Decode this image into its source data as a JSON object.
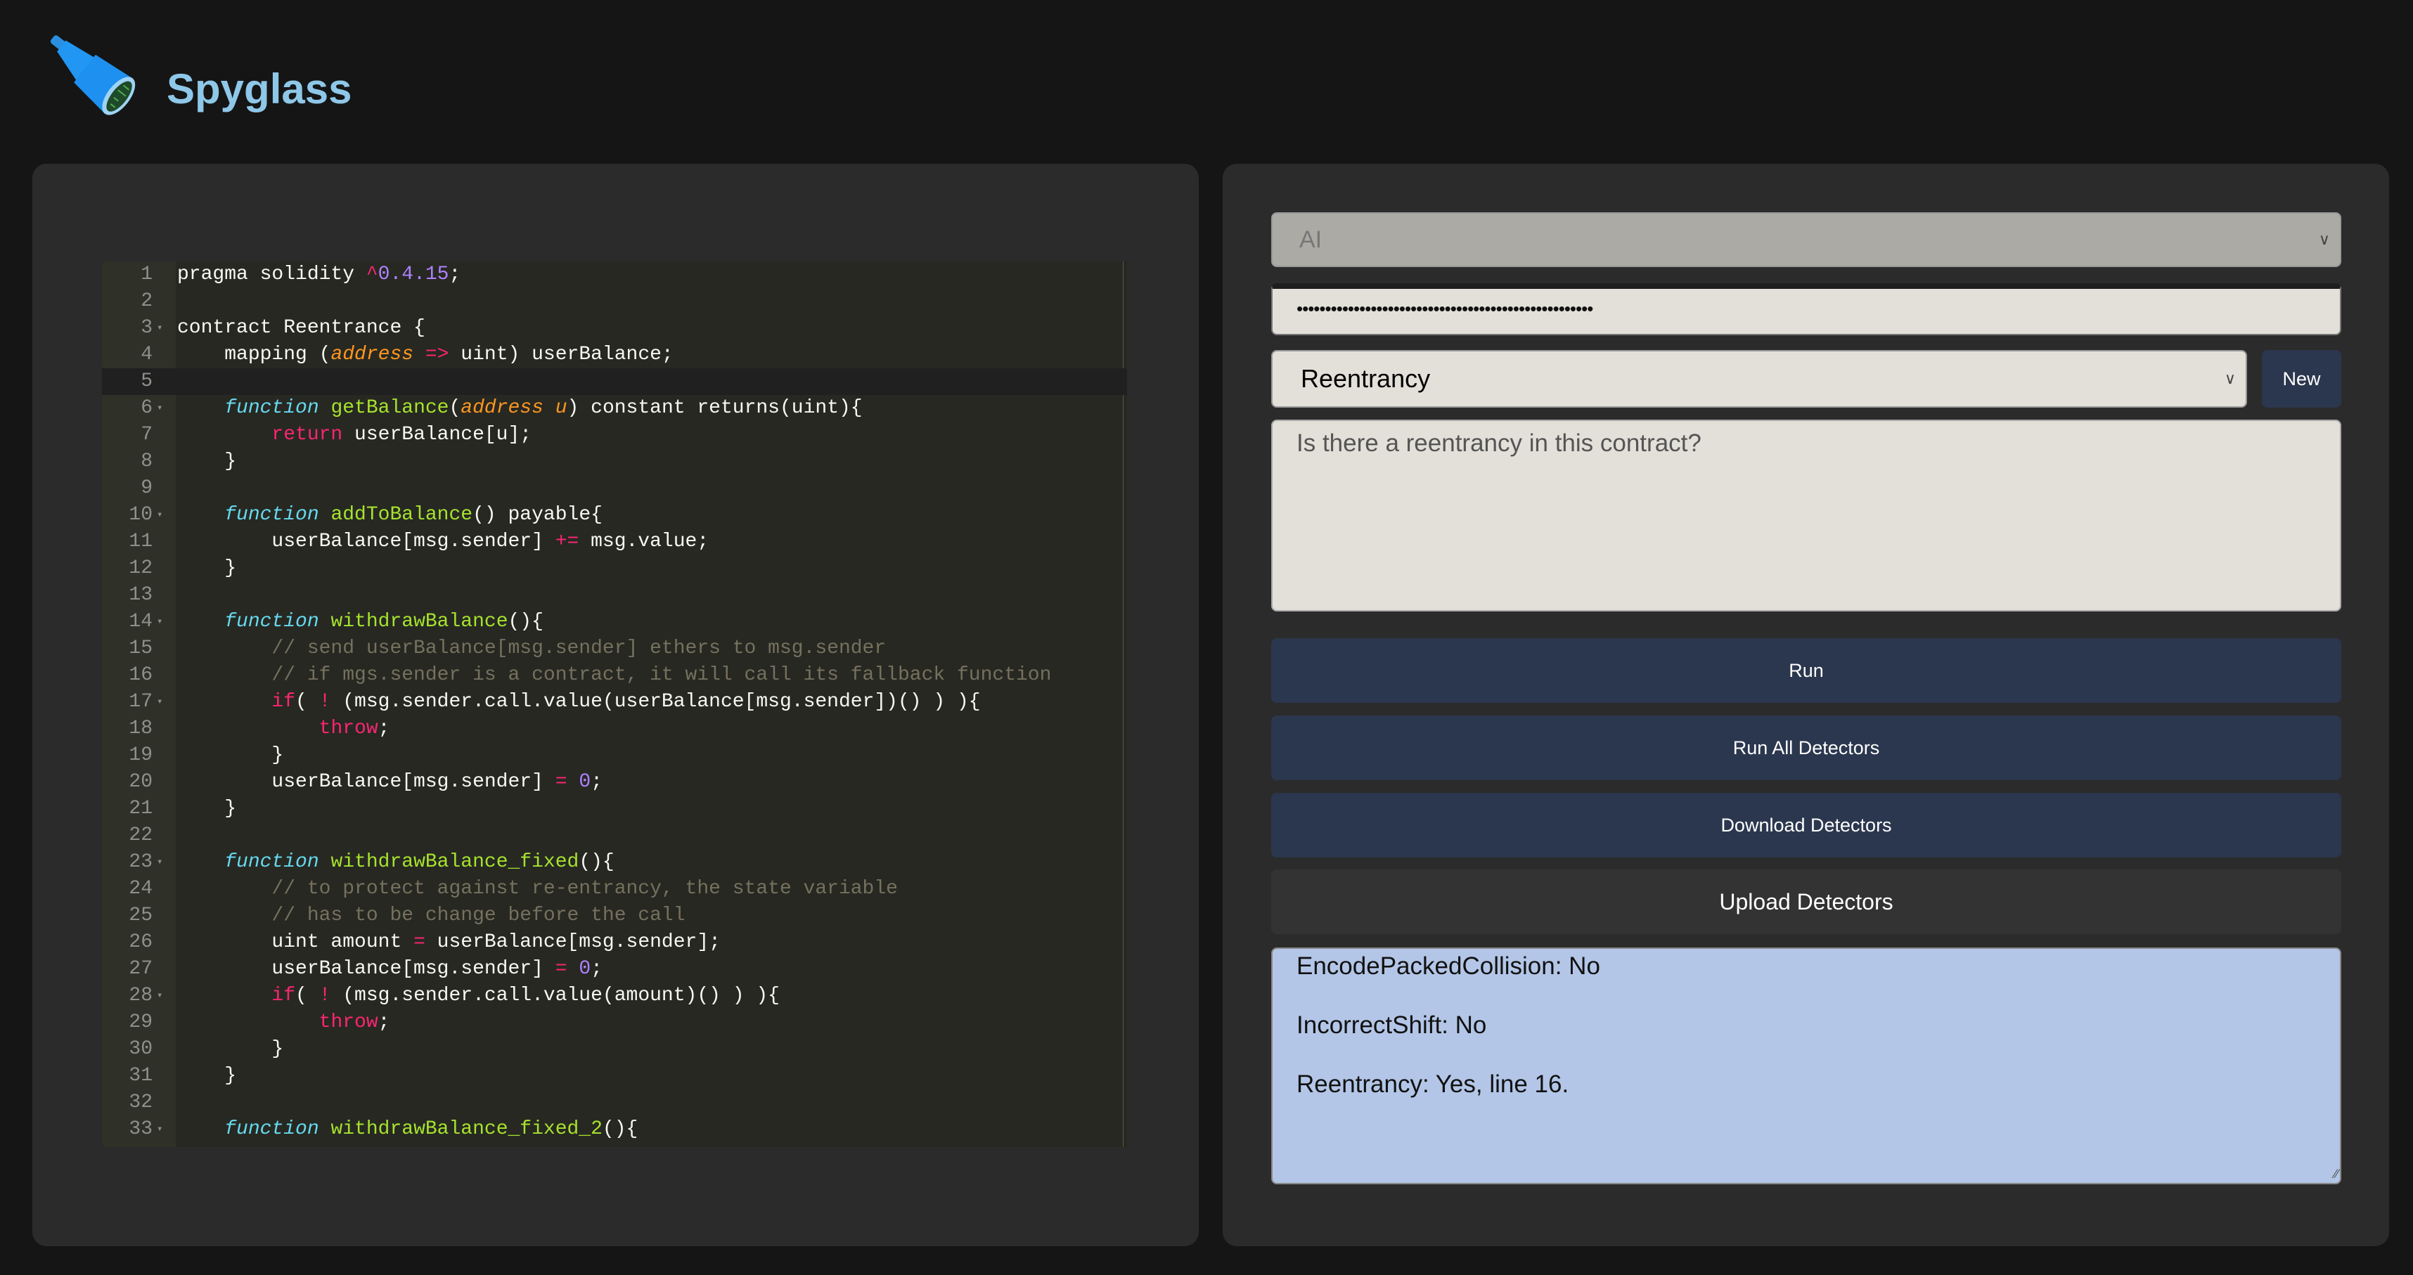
{
  "app": {
    "title": "Spyglass",
    "logo_icon": "spyglass-telescope-icon"
  },
  "editor": {
    "active_line": 5,
    "fold_lines": [
      3,
      6,
      10,
      14,
      17,
      23,
      28,
      33
    ],
    "lines": [
      [
        [
          "plain",
          "pragma solidity "
        ],
        [
          "op",
          "^"
        ],
        [
          "num",
          "0.4.15"
        ],
        [
          "plain",
          ";"
        ]
      ],
      [],
      [
        [
          "plain",
          "contract Reentrance {"
        ]
      ],
      [
        [
          "plain",
          "    mapping ("
        ],
        [
          "type",
          "address"
        ],
        [
          "plain",
          " "
        ],
        [
          "op",
          "=>"
        ],
        [
          "plain",
          " uint) userBalance;"
        ]
      ],
      [
        [
          "plain",
          "    "
        ]
      ],
      [
        [
          "plain",
          "    "
        ],
        [
          "fn",
          "function"
        ],
        [
          "plain",
          " "
        ],
        [
          "name",
          "getBalance"
        ],
        [
          "plain",
          "("
        ],
        [
          "type",
          "address u"
        ],
        [
          "plain",
          ") constant returns(uint){"
        ]
      ],
      [
        [
          "plain",
          "        "
        ],
        [
          "kw",
          "return"
        ],
        [
          "plain",
          " userBalance[u];"
        ]
      ],
      [
        [
          "plain",
          "    }"
        ]
      ],
      [],
      [
        [
          "plain",
          "    "
        ],
        [
          "fn",
          "function"
        ],
        [
          "plain",
          " "
        ],
        [
          "name",
          "addToBalance"
        ],
        [
          "plain",
          "() payable{"
        ]
      ],
      [
        [
          "plain",
          "        userBalance[msg.sender] "
        ],
        [
          "op",
          "+="
        ],
        [
          "plain",
          " msg.value;"
        ]
      ],
      [
        [
          "plain",
          "    }"
        ]
      ],
      [],
      [
        [
          "plain",
          "    "
        ],
        [
          "fn",
          "function"
        ],
        [
          "plain",
          " "
        ],
        [
          "name",
          "withdrawBalance"
        ],
        [
          "plain",
          "(){"
        ]
      ],
      [
        [
          "plain",
          "        "
        ],
        [
          "cm",
          "// send userBalance[msg.sender] ethers to msg.sender"
        ]
      ],
      [
        [
          "plain",
          "        "
        ],
        [
          "cm",
          "// if mgs.sender is a contract, it will call its fallback function"
        ]
      ],
      [
        [
          "plain",
          "        "
        ],
        [
          "kw",
          "if"
        ],
        [
          "plain",
          "( "
        ],
        [
          "op",
          "!"
        ],
        [
          "plain",
          " (msg.sender.call.value(userBalance[msg.sender])() ) ){"
        ]
      ],
      [
        [
          "plain",
          "            "
        ],
        [
          "kw",
          "throw"
        ],
        [
          "plain",
          ";"
        ]
      ],
      [
        [
          "plain",
          "        }"
        ]
      ],
      [
        [
          "plain",
          "        userBalance[msg.sender] "
        ],
        [
          "op",
          "="
        ],
        [
          "plain",
          " "
        ],
        [
          "num",
          "0"
        ],
        [
          "plain",
          ";"
        ]
      ],
      [
        [
          "plain",
          "    }"
        ]
      ],
      [],
      [
        [
          "plain",
          "    "
        ],
        [
          "fn",
          "function"
        ],
        [
          "plain",
          " "
        ],
        [
          "name",
          "withdrawBalance_fixed"
        ],
        [
          "plain",
          "(){"
        ]
      ],
      [
        [
          "plain",
          "        "
        ],
        [
          "cm",
          "// to protect against re-entrancy, the state variable"
        ]
      ],
      [
        [
          "plain",
          "        "
        ],
        [
          "cm",
          "// has to be change before the call"
        ]
      ],
      [
        [
          "plain",
          "        uint amount "
        ],
        [
          "op",
          "="
        ],
        [
          "plain",
          " userBalance[msg.sender];"
        ]
      ],
      [
        [
          "plain",
          "        userBalance[msg.sender] "
        ],
        [
          "op",
          "="
        ],
        [
          "plain",
          " "
        ],
        [
          "num",
          "0"
        ],
        [
          "plain",
          ";"
        ]
      ],
      [
        [
          "plain",
          "        "
        ],
        [
          "kw",
          "if"
        ],
        [
          "plain",
          "( "
        ],
        [
          "op",
          "!"
        ],
        [
          "plain",
          " (msg.sender.call.value(amount)() ) ){"
        ]
      ],
      [
        [
          "plain",
          "            "
        ],
        [
          "kw",
          "throw"
        ],
        [
          "plain",
          ";"
        ]
      ],
      [
        [
          "plain",
          "        }"
        ]
      ],
      [
        [
          "plain",
          "    }"
        ]
      ],
      [],
      [
        [
          "plain",
          "    "
        ],
        [
          "fn",
          "function"
        ],
        [
          "plain",
          " "
        ],
        [
          "name",
          "withdrawBalance_fixed_2"
        ],
        [
          "plain",
          "(){"
        ]
      ]
    ]
  },
  "controls": {
    "model_select": "AI",
    "api_key_masked": "••••••••••••••••••••••••••••••••••••••••••••••••••••",
    "detector_select": "Reentrancy",
    "new_label": "New",
    "prompt": "Is there a reentrancy in this contract?",
    "run_label": "Run",
    "run_all_label": "Run All Detectors",
    "download_label": "Download Detectors",
    "upload_label": "Upload Detectors"
  },
  "output": {
    "lines": [
      "EncodePackedCollision: No",
      "IncorrectShift: No",
      "Reentrancy: Yes, line 16."
    ]
  },
  "colors": {
    "accent": "#8ec7e8",
    "button": "#2b374e",
    "output_bg": "#b3c6e7"
  }
}
